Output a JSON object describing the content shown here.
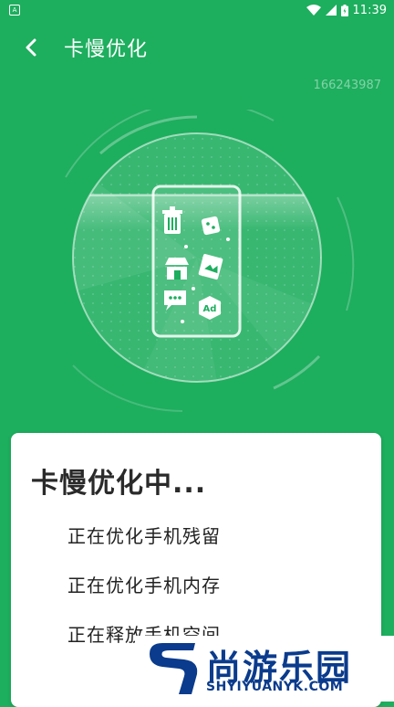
{
  "status_bar": {
    "app_badge": "A",
    "time": "11:39",
    "icons": [
      "wifi-icon",
      "signal-icon",
      "battery-icon"
    ]
  },
  "header": {
    "back_icon": "chevron-left-icon",
    "title": "卡慢优化"
  },
  "device_id": "166243987",
  "hero": {
    "icons": [
      "trash-icon",
      "dice-icon",
      "store-icon",
      "image-file-icon",
      "chat-icon",
      "ad-icon"
    ],
    "ad_label": "Ad"
  },
  "card": {
    "title": "卡慢优化中...",
    "tasks": [
      "正在优化手机残留",
      "正在优化手机内存",
      "正在释放手机空间"
    ]
  },
  "watermark": {
    "chinese": "尚游乐园",
    "english": "SHYIYUANYK.COM"
  },
  "colors": {
    "background": "#1dae5e",
    "card": "#ffffff",
    "watermark": "#0a3b8c"
  }
}
